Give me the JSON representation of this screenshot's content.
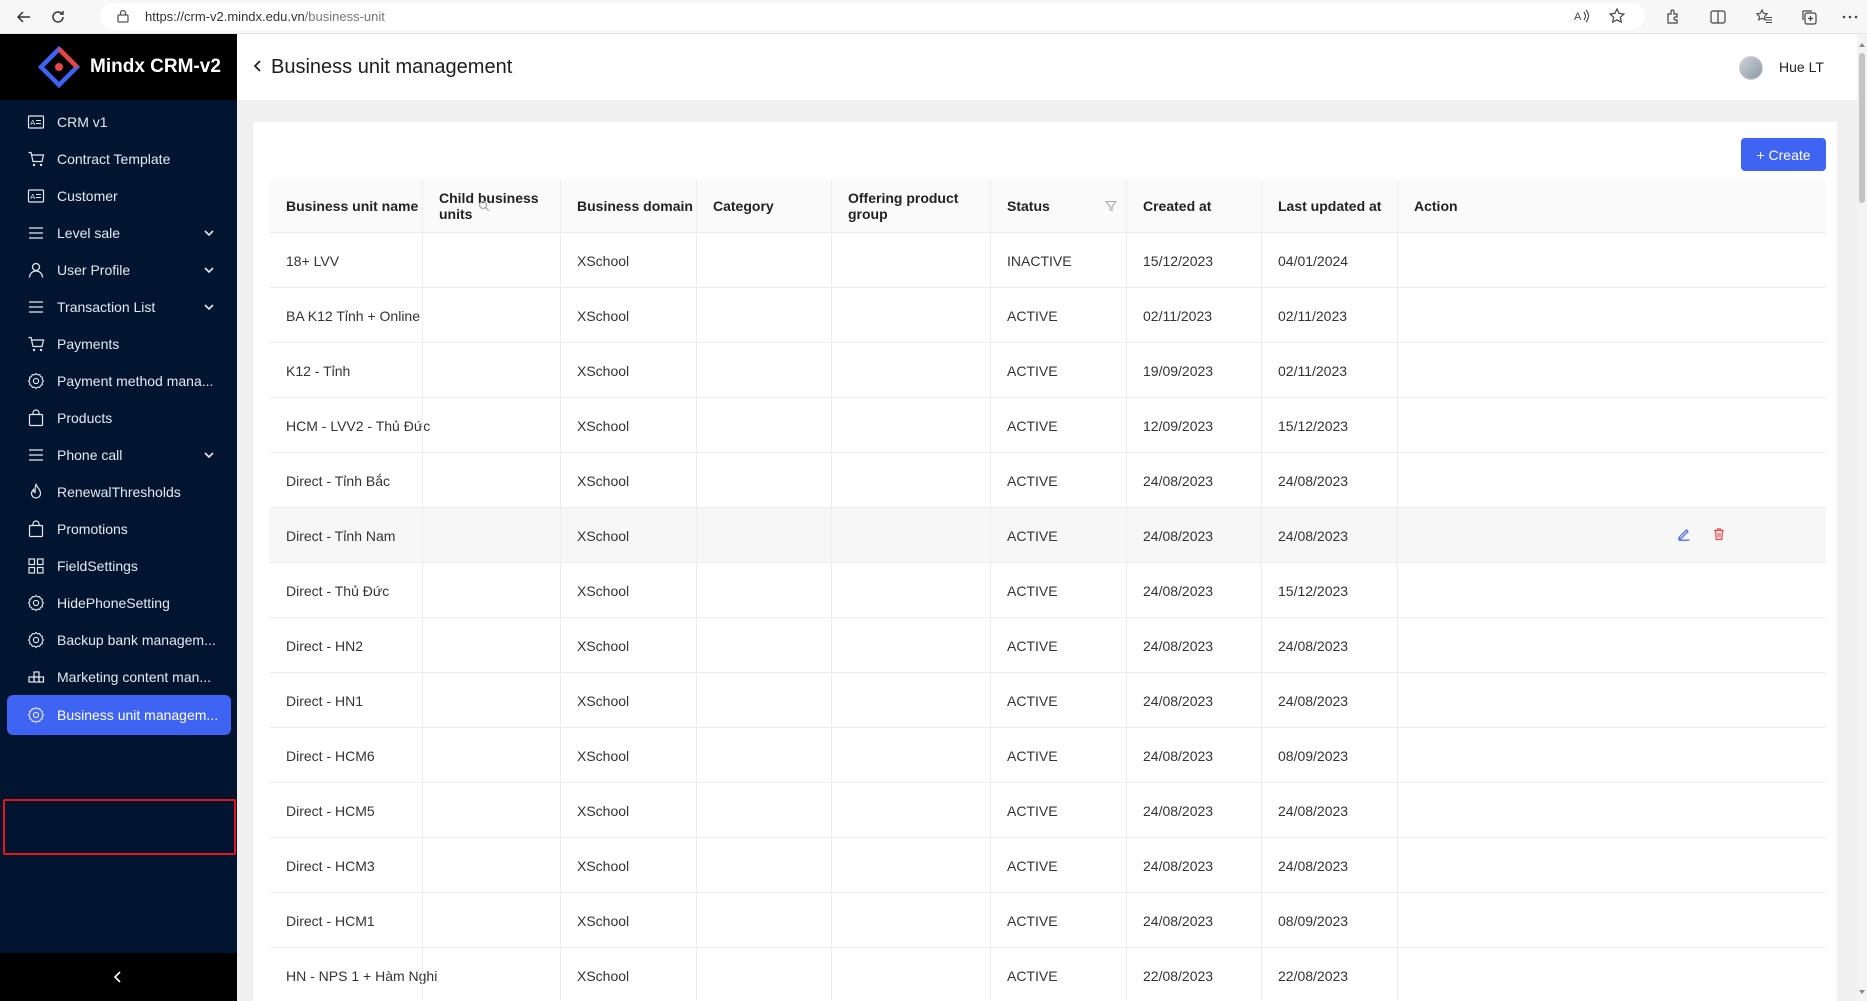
{
  "browser": {
    "url_host": "https://crm-v2.mindx.edu.vn",
    "url_path": "/business-unit"
  },
  "brand": {
    "name": "Mindx CRM-v2"
  },
  "sidebar": {
    "items": [
      {
        "label": "CRM v1",
        "icon": "id-card-icon",
        "has_submenu": false
      },
      {
        "label": "Contract Template",
        "icon": "cart-icon",
        "has_submenu": false
      },
      {
        "label": "Customer",
        "icon": "id-card-icon",
        "has_submenu": false
      },
      {
        "label": "Level sale",
        "icon": "menu-icon",
        "has_submenu": true
      },
      {
        "label": "User Profile",
        "icon": "user-icon",
        "has_submenu": true
      },
      {
        "label": "Transaction List",
        "icon": "menu-icon",
        "has_submenu": true
      },
      {
        "label": "Payments",
        "icon": "cart-icon",
        "has_submenu": false
      },
      {
        "label": "Payment method mana...",
        "icon": "gear-icon",
        "has_submenu": false
      },
      {
        "label": "Products",
        "icon": "bag-icon",
        "has_submenu": false
      },
      {
        "label": "Phone call",
        "icon": "menu-icon",
        "has_submenu": true
      },
      {
        "label": "RenewalThresholds",
        "icon": "fire-icon",
        "has_submenu": false
      },
      {
        "label": "Promotions",
        "icon": "bag-icon",
        "has_submenu": false
      },
      {
        "label": "FieldSettings",
        "icon": "grid-icon",
        "has_submenu": false
      },
      {
        "label": "HidePhoneSetting",
        "icon": "gear-icon",
        "has_submenu": false
      },
      {
        "label": "Backup bank managem...",
        "icon": "gear-icon",
        "has_submenu": false
      },
      {
        "label": "Marketing content man...",
        "icon": "blocks-icon",
        "has_submenu": false
      },
      {
        "label": "Business unit managem...",
        "icon": "gear-icon",
        "has_submenu": false,
        "active": true
      }
    ]
  },
  "header": {
    "title": "Business unit management",
    "user_name": "Hue LT"
  },
  "toolbar": {
    "create_label": "+ Create"
  },
  "table": {
    "columns": [
      "Business unit name",
      "Child business units",
      "Business domain",
      "Category",
      "Offering product group",
      "Status",
      "Created at",
      "Last updated at",
      "Action"
    ],
    "rows": [
      {
        "name": "18+ LVV",
        "child": "",
        "domain": "XSchool",
        "category": "",
        "offering": "",
        "status": "INACTIVE",
        "created": "15/12/2023",
        "updated": "04/01/2024"
      },
      {
        "name": "BA K12 Tỉnh + Online",
        "child": "",
        "domain": "XSchool",
        "category": "",
        "offering": "",
        "status": "ACTIVE",
        "created": "02/11/2023",
        "updated": "02/11/2023"
      },
      {
        "name": "K12 - Tỉnh",
        "child": "",
        "domain": "XSchool",
        "category": "",
        "offering": "",
        "status": "ACTIVE",
        "created": "19/09/2023",
        "updated": "02/11/2023"
      },
      {
        "name": "HCM - LVV2 - Thủ Đức",
        "child": "",
        "domain": "XSchool",
        "category": "",
        "offering": "",
        "status": "ACTIVE",
        "created": "12/09/2023",
        "updated": "15/12/2023"
      },
      {
        "name": "Direct - Tỉnh Bắc",
        "child": "",
        "domain": "XSchool",
        "category": "",
        "offering": "",
        "status": "ACTIVE",
        "created": "24/08/2023",
        "updated": "24/08/2023"
      },
      {
        "name": "Direct - Tỉnh Nam",
        "child": "",
        "domain": "XSchool",
        "category": "",
        "offering": "",
        "status": "ACTIVE",
        "created": "24/08/2023",
        "updated": "24/08/2023",
        "hover": true
      },
      {
        "name": "Direct - Thủ Đức",
        "child": "",
        "domain": "XSchool",
        "category": "",
        "offering": "",
        "status": "ACTIVE",
        "created": "24/08/2023",
        "updated": "15/12/2023"
      },
      {
        "name": "Direct - HN2",
        "child": "",
        "domain": "XSchool",
        "category": "",
        "offering": "",
        "status": "ACTIVE",
        "created": "24/08/2023",
        "updated": "24/08/2023"
      },
      {
        "name": "Direct - HN1",
        "child": "",
        "domain": "XSchool",
        "category": "",
        "offering": "",
        "status": "ACTIVE",
        "created": "24/08/2023",
        "updated": "24/08/2023"
      },
      {
        "name": "Direct - HCM6",
        "child": "",
        "domain": "XSchool",
        "category": "",
        "offering": "",
        "status": "ACTIVE",
        "created": "24/08/2023",
        "updated": "08/09/2023"
      },
      {
        "name": "Direct - HCM5",
        "child": "",
        "domain": "XSchool",
        "category": "",
        "offering": "",
        "status": "ACTIVE",
        "created": "24/08/2023",
        "updated": "24/08/2023"
      },
      {
        "name": "Direct - HCM3",
        "child": "",
        "domain": "XSchool",
        "category": "",
        "offering": "",
        "status": "ACTIVE",
        "created": "24/08/2023",
        "updated": "24/08/2023"
      },
      {
        "name": "Direct - HCM1",
        "child": "",
        "domain": "XSchool",
        "category": "",
        "offering": "",
        "status": "ACTIVE",
        "created": "24/08/2023",
        "updated": "08/09/2023"
      },
      {
        "name": "HN - NPS 1 + Hàm Nghi",
        "child": "",
        "domain": "XSchool",
        "category": "",
        "offering": "",
        "status": "ACTIVE",
        "created": "22/08/2023",
        "updated": "22/08/2023"
      }
    ]
  },
  "colors": {
    "sidebar_bg": "#011531",
    "accent": "#3f63f2",
    "highlight_outline": "#e3161c",
    "delete_icon": "#e5484d"
  }
}
